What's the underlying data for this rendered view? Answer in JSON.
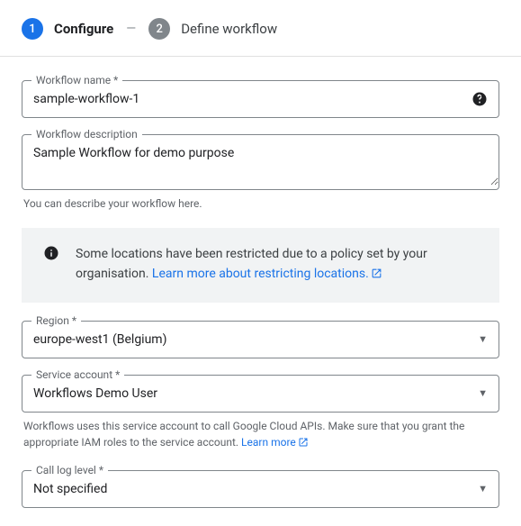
{
  "stepper": {
    "step1_number": "1",
    "step1_label": "Configure",
    "connector": "—",
    "step2_number": "2",
    "step2_label": "Define workflow"
  },
  "fields": {
    "workflow_name": {
      "label": "Workflow name *",
      "value": "sample-workflow-1"
    },
    "workflow_description": {
      "label": "Workflow description",
      "value": "Sample Workflow for demo purpose",
      "helper": "You can describe your workflow here."
    },
    "region": {
      "label": "Region *",
      "value": "europe-west1 (Belgium)"
    },
    "service_account": {
      "label": "Service account *",
      "value": "Workflows Demo User",
      "helper_prefix": "Workflows uses this service account to call Google Cloud APIs. Make sure that you grant the appropriate IAM roles to the service account. ",
      "helper_link": "Learn more"
    },
    "call_log_level": {
      "label": "Call log level *",
      "value": "Not specified"
    }
  },
  "info_box": {
    "text_prefix": "Some locations have been restricted due to a policy set by your organisation. ",
    "link_text": "Learn more about restricting locations."
  }
}
